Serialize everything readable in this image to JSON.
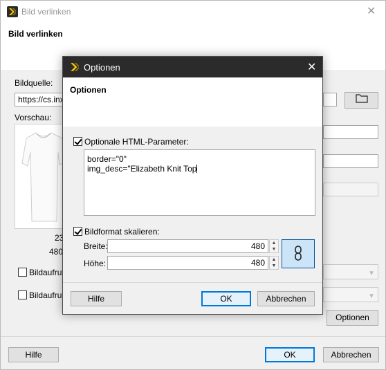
{
  "back_window": {
    "title": "Bild verlinken",
    "header_title": "Bild verlinken",
    "source_label": "Bildquelle:",
    "source_value": "https://cs.inxe",
    "preview_label": "Vorschau:",
    "size_text_1": "23",
    "size_text_2": "480x",
    "checkbox1_label": "Bildaufruf",
    "checkbox2_label": "Bildaufruf",
    "options_button": "Optionen",
    "help_button": "Hilfe",
    "ok_button": "OK",
    "cancel_button": "Abbrechen"
  },
  "dialog": {
    "title": "Optionen",
    "header_title": "Optionen",
    "html_params_label": "Optionale HTML-Parameter:",
    "html_params_checked": true,
    "html_params_lines": [
      "border=\"0\"",
      "img_desc=\"Elizabeth Knit Top"
    ],
    "scale_label": "Bildformat skalieren:",
    "scale_checked": true,
    "width_label": "Breite:",
    "width_value": "480",
    "height_label": "Höhe:",
    "height_value": "480",
    "help_button": "Hilfe",
    "ok_button": "OK",
    "cancel_button": "Abbrechen"
  },
  "icons": [
    "app-logo-icon",
    "close-icon",
    "folder-icon",
    "chevron-down-icon",
    "link-chain-icon",
    "spin-up-icon",
    "spin-down-icon"
  ],
  "colors": {
    "dialog_titlebar": "#2b2b2b",
    "default_button_border": "#0078d7",
    "link_button_bg": "#cce4f7",
    "window_bg": "#f0f0f0"
  }
}
